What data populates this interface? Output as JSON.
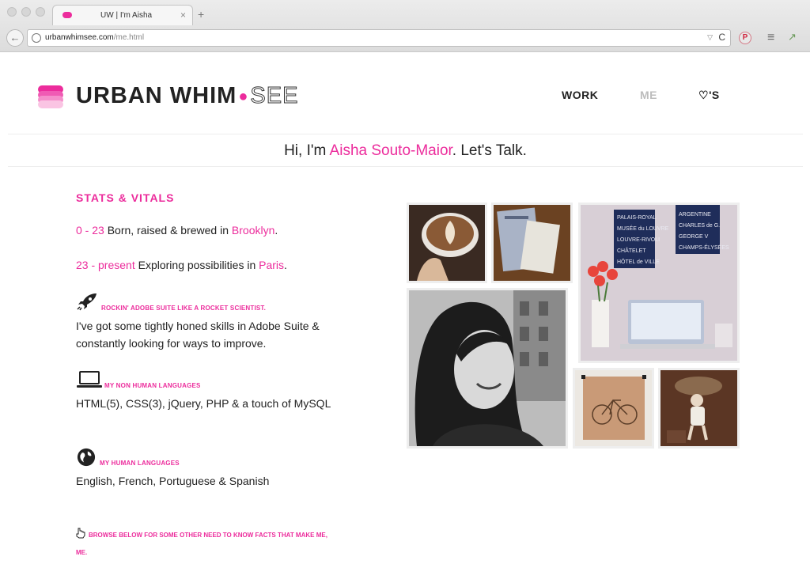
{
  "browser": {
    "tab_title": "UW | I'm Aisha",
    "tab_close": "×",
    "new_tab": "+",
    "url_host": "urbanwhimsee.com",
    "url_path": "/me.html",
    "pinterest_glyph": "P",
    "menu_glyph": "≡",
    "ext_glyph": "↗",
    "back_glyph": "←",
    "reload_glyph": "C"
  },
  "site": {
    "logo_word_1": "URBAN WHIM",
    "logo_dot": "●",
    "logo_word_2": "SEE",
    "nav": {
      "work": "WORK",
      "me": "ME",
      "hearts_symbol": "♡",
      "hearts_suffix": "'S"
    },
    "intro": {
      "prefix": "Hi, I'm ",
      "name": "Aisha Souto-Maior",
      "suffix": ". Let's Talk."
    }
  },
  "stats": {
    "heading": "STATS & VITALS",
    "items": [
      {
        "range": "0 - 23",
        "text": " Born, raised & brewed in ",
        "place": "Brooklyn",
        "end": "."
      },
      {
        "range": "23 - present",
        "text": " Exploring possibilities in ",
        "place": "Paris",
        "end": "."
      }
    ],
    "features": [
      {
        "icon": "rocket-icon",
        "label": "ROCKIN' ADOBE SUITE LIKE A ROCKET SCIENTIST.",
        "text": "I've got some tightly honed skills in Adobe Suite & constantly looking for ways to improve."
      },
      {
        "icon": "laptop-icon",
        "label": "MY NON HUMAN LANGUAGES",
        "text": "HTML(5), CSS(3), jQuery, PHP & a touch of MySQL"
      },
      {
        "icon": "globe-icon",
        "label": "MY HUMAN LANGUAGES",
        "text": "English, French, Portuguese & Spanish"
      }
    ],
    "browse_note": "BROWSE BELOW FOR SOME OTHER NEED TO KNOW FACTS THAT MAKE ME, ME."
  },
  "colors": {
    "accent": "#ec2c9c",
    "text": "#222222",
    "muted": "#bdbdbd"
  },
  "photos": [
    {
      "name": "photo-latte",
      "alt_icon": "coffee-photo"
    },
    {
      "name": "photo-papers",
      "alt_icon": "papers-photo"
    },
    {
      "name": "photo-workspace",
      "alt_icon": "workspace-photo"
    },
    {
      "name": "photo-portrait",
      "alt_icon": "portrait-photo"
    },
    {
      "name": "photo-bike-drawing",
      "alt_icon": "bike-drawing-photo"
    },
    {
      "name": "photo-child",
      "alt_icon": "child-photo"
    }
  ]
}
